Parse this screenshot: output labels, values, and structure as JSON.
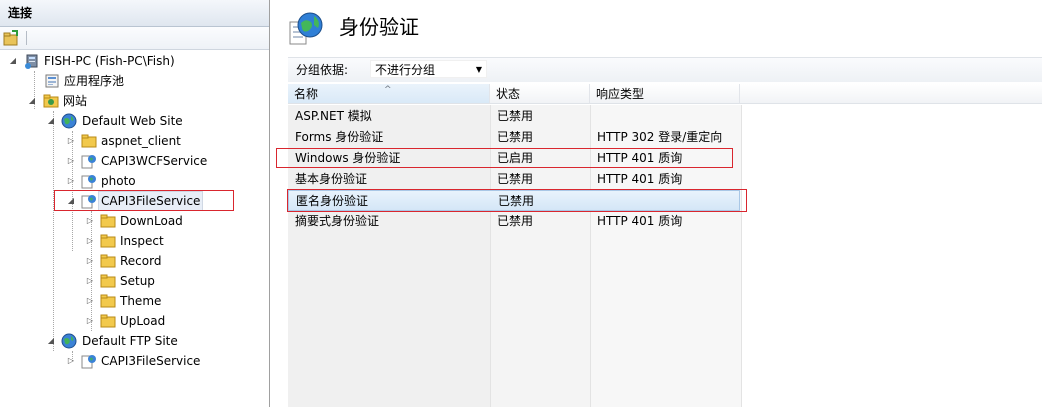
{
  "connections": {
    "header": "连接",
    "tree": [
      {
        "label": "FISH-PC (Fish-PC\\Fish)",
        "icon": "server-icon",
        "expander": "expanded",
        "level": 0
      },
      {
        "label": "应用程序池",
        "icon": "app-pool-icon",
        "expander": "none",
        "level": 1
      },
      {
        "label": "网站",
        "icon": "sites-folder-icon",
        "expander": "expanded",
        "level": 1
      },
      {
        "label": "Default Web Site",
        "icon": "globe-icon",
        "expander": "expanded",
        "level": 2
      },
      {
        "label": "aspnet_client",
        "icon": "folder-icon",
        "expander": "collapsed",
        "level": 3
      },
      {
        "label": "CAPI3WCFService",
        "icon": "web-app-icon",
        "expander": "collapsed",
        "level": 3
      },
      {
        "label": "photo",
        "icon": "web-app-icon",
        "expander": "collapsed",
        "level": 3
      },
      {
        "label": "CAPI3FileService",
        "icon": "web-app-icon",
        "expander": "expanded",
        "level": 3,
        "selected": true
      },
      {
        "label": "DownLoad",
        "icon": "folder-icon",
        "expander": "collapsed",
        "level": 4
      },
      {
        "label": "Inspect",
        "icon": "folder-icon",
        "expander": "collapsed",
        "level": 4
      },
      {
        "label": "Record",
        "icon": "folder-icon",
        "expander": "collapsed",
        "level": 4
      },
      {
        "label": "Setup",
        "icon": "folder-icon",
        "expander": "collapsed",
        "level": 4
      },
      {
        "label": "Theme",
        "icon": "folder-icon",
        "expander": "collapsed",
        "level": 4
      },
      {
        "label": "UpLoad",
        "icon": "folder-icon",
        "expander": "collapsed",
        "level": 4
      },
      {
        "label": "Default FTP Site",
        "icon": "globe-icon",
        "expander": "expanded",
        "level": 2
      },
      {
        "label": "CAPI3FileService",
        "icon": "web-app-icon",
        "expander": "collapsed",
        "level": 3
      }
    ]
  },
  "main": {
    "title": "身份验证",
    "group_by_label": "分组依据:",
    "group_by_value": "不进行分组",
    "columns": [
      "名称",
      "状态",
      "响应类型"
    ],
    "rows": [
      {
        "name": "ASP.NET 模拟",
        "status": "已禁用",
        "response": ""
      },
      {
        "name": "Forms 身份验证",
        "status": "已禁用",
        "response": "HTTP 302 登录/重定向"
      },
      {
        "name": "Windows 身份验证",
        "status": "已启用",
        "response": "HTTP 401 质询"
      },
      {
        "name": "基本身份验证",
        "status": "已禁用",
        "response": "HTTP 401 质询"
      },
      {
        "name": "匿名身份验证",
        "status": "已禁用",
        "response": "",
        "selected": true
      },
      {
        "name": "摘要式身份验证",
        "status": "已禁用",
        "response": "HTTP 401 质询"
      }
    ]
  },
  "colors": {
    "highlight_box": "#d9262e",
    "selection": "#d4e6f7",
    "folder": "#f2c94c"
  }
}
